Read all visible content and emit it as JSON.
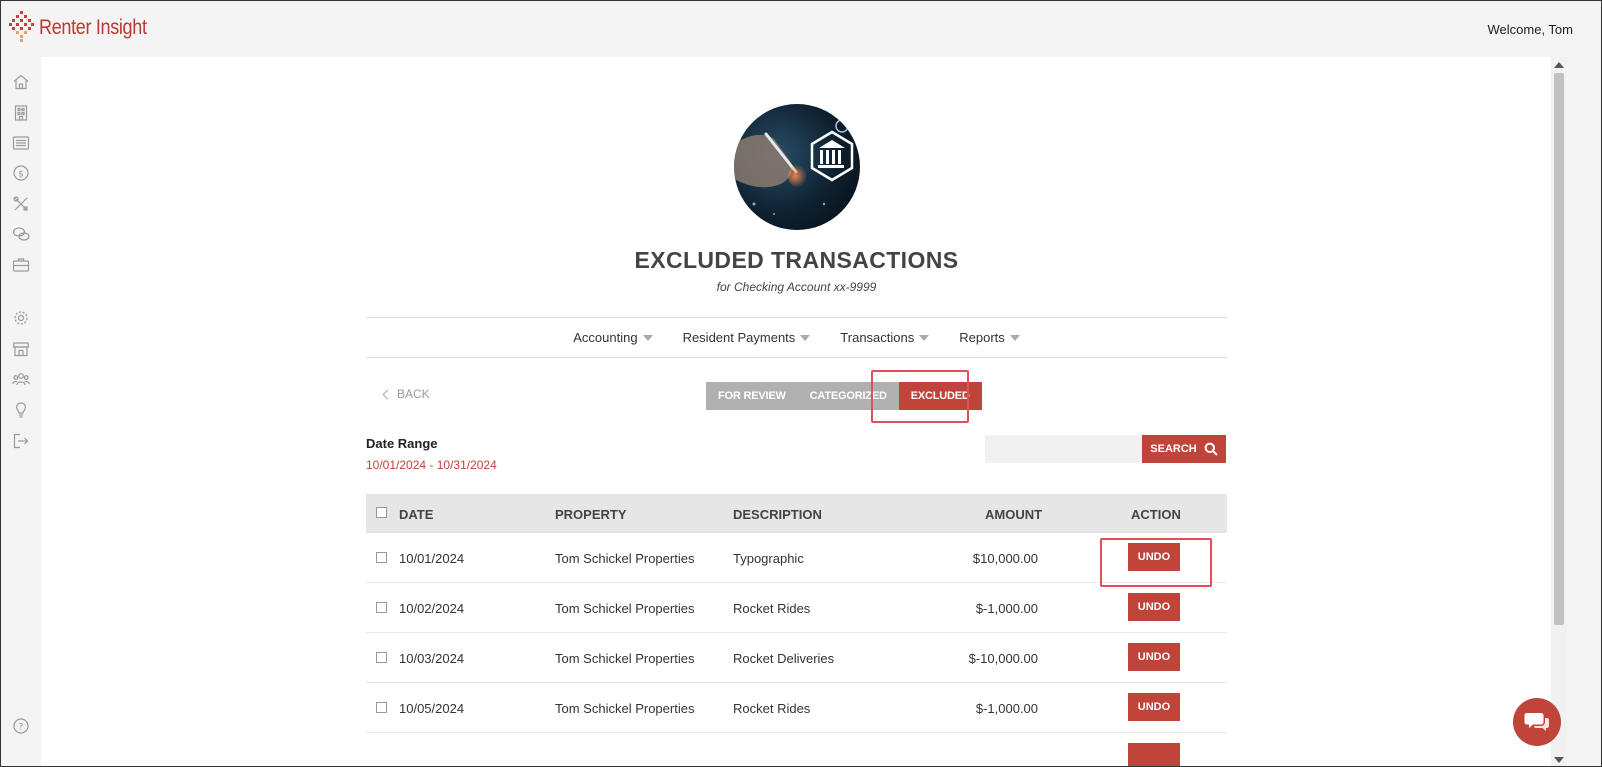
{
  "app": {
    "brand": "Renter Insight",
    "welcome": "Welcome, Tom",
    "colors": {
      "accent": "#c0443a",
      "tab_inactive": "#b0b0b0",
      "highlight": "#e0505a"
    }
  },
  "sidebar": {
    "items": [
      {
        "icon": "home-icon"
      },
      {
        "icon": "building-icon"
      },
      {
        "icon": "list-icon"
      },
      {
        "icon": "dollar-icon"
      },
      {
        "icon": "tools-icon"
      },
      {
        "icon": "chat-icon"
      },
      {
        "icon": "briefcase-icon"
      },
      {
        "icon": "gear-icon"
      },
      {
        "icon": "store-icon"
      },
      {
        "icon": "people-icon"
      },
      {
        "icon": "lightbulb-icon"
      },
      {
        "icon": "logout-icon"
      }
    ],
    "help_icon": "help-icon"
  },
  "header": {
    "title": "EXCLUDED TRANSACTIONS",
    "subtitle": "for Checking Account xx-9999"
  },
  "nav": {
    "items": [
      {
        "label": "Accounting"
      },
      {
        "label": "Resident Payments"
      },
      {
        "label": "Transactions"
      },
      {
        "label": "Reports"
      }
    ]
  },
  "back_label": "BACK",
  "tabs": [
    {
      "label": "FOR REVIEW",
      "active": false
    },
    {
      "label": "CATEGORIZED",
      "active": false
    },
    {
      "label": "EXCLUDED",
      "active": true
    }
  ],
  "date_range": {
    "label": "Date Range",
    "value": "10/01/2024 - 10/31/2024"
  },
  "search": {
    "value": "",
    "button_label": "SEARCH"
  },
  "table": {
    "columns": [
      "DATE",
      "PROPERTY",
      "DESCRIPTION",
      "AMOUNT",
      "ACTION"
    ],
    "rows": [
      {
        "date": "10/01/2024",
        "property": "Tom Schickel Properties",
        "description": "Typographic",
        "amount": "$10,000.00",
        "action": "UNDO"
      },
      {
        "date": "10/02/2024",
        "property": "Tom Schickel Properties",
        "description": "Rocket Rides",
        "amount": "$-1,000.00",
        "action": "UNDO"
      },
      {
        "date": "10/03/2024",
        "property": "Tom Schickel Properties",
        "description": "Rocket Deliveries",
        "amount": "$-10,000.00",
        "action": "UNDO"
      },
      {
        "date": "10/05/2024",
        "property": "Tom Schickel Properties",
        "description": "Rocket Rides",
        "amount": "$-1,000.00",
        "action": "UNDO"
      }
    ]
  }
}
